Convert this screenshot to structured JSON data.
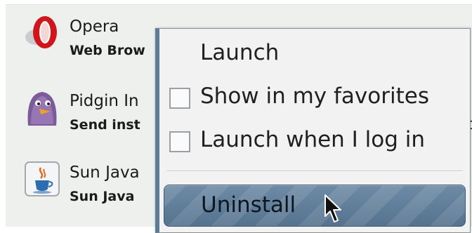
{
  "apps": [
    {
      "name": "Opera",
      "description": "Web Brow",
      "icon": "opera-icon"
    },
    {
      "name": "Pidgin In",
      "description": "Send inst",
      "icon": "pidgin-icon"
    },
    {
      "name": "Sun Java",
      "description": "Sun Java",
      "icon": "java-icon"
    }
  ],
  "stray_text": "c",
  "context_menu": {
    "launch": "Launch",
    "show_in_favorites": "Show in my favorites",
    "launch_on_login": "Launch when I log in",
    "uninstall": "Uninstall"
  },
  "colors": {
    "menu_border_accent": "#5d7c99",
    "selected_item_bg": "#6e8ba6"
  }
}
